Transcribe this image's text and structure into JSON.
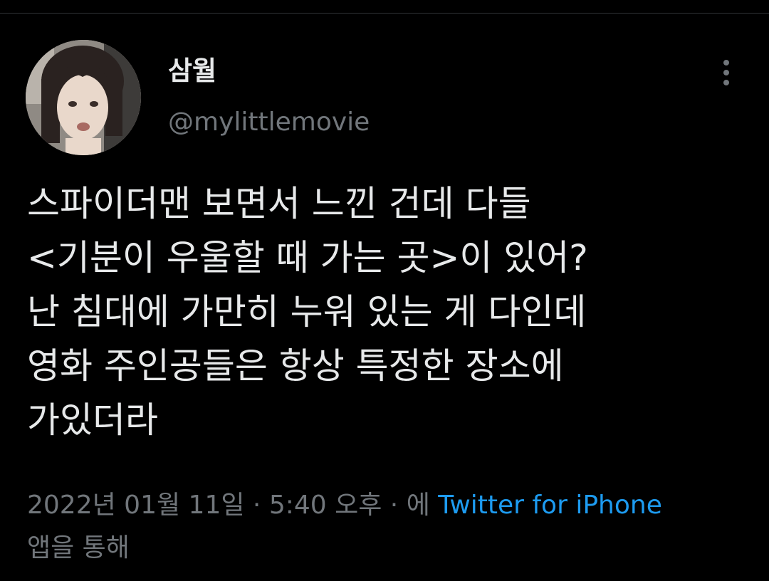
{
  "tweet": {
    "author": {
      "display_name": "삼월",
      "handle": "@mylittlemovie",
      "avatar_icon": "profile-photo-woman-icon"
    },
    "more_icon": "vertical-ellipsis-icon",
    "text_lines": [
      "스파이더맨 보면서 느낀 건데 다들",
      "<기분이 우울할 때 가는 곳>이 있어?",
      "난 침대에 가만히 누워 있는 게 다인데",
      "영화 주인공들은 항상 특정한 장소에",
      "가있더라"
    ],
    "meta": {
      "date": "2022년 01월 11일",
      "separator": " · ",
      "time": "5:40 오후",
      "via_prefix": "에 ",
      "source": "Twitter for iPhone",
      "via_suffix": "앱을 통해"
    }
  },
  "colors": {
    "background": "#000000",
    "primary_text": "#e7e9ea",
    "secondary_text": "#71767b",
    "link": "#1d9bf0"
  }
}
